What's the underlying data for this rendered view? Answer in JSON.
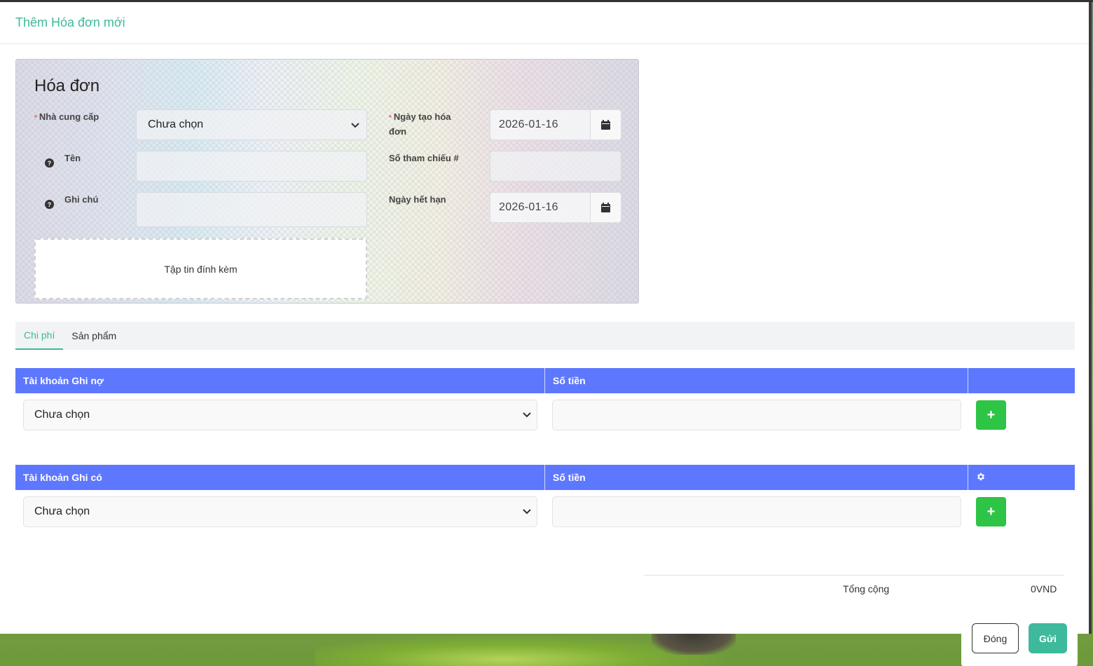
{
  "modal": {
    "title": "Thêm Hóa đơn mới"
  },
  "invoice": {
    "title": "Hóa đơn",
    "supplier_label": "Nhà cung cấp",
    "supplier_value": "Chưa chọn",
    "name_label": "Tên",
    "note_label": "Ghi chú",
    "created_date_label_line1": "Ngày tạo hóa",
    "created_date_label_line2": "đơn",
    "created_date_value": "2026-01-16",
    "reference_label": "Số tham chiếu #",
    "due_date_label": "Ngày hết hạn",
    "due_date_value": "2026-01-16",
    "attachment_label": "Tập tin đính kèm"
  },
  "tabs": [
    {
      "label": "Chi phí",
      "active": true
    },
    {
      "label": "Sản phẩm",
      "active": false
    }
  ],
  "debit_table": {
    "col_account": "Tài khoản Ghi nợ",
    "col_amount": "Số tiền",
    "account_value": "Chưa chọn",
    "add_label": "+"
  },
  "credit_table": {
    "col_account": "Tài khoản Ghi có",
    "col_amount": "Số tiền",
    "account_value": "Chưa chọn",
    "add_label": "+"
  },
  "totals": {
    "label": "Tổng cộng",
    "value": "0VND"
  },
  "footer": {
    "close_label": "Đóng",
    "send_label": "Gửi"
  },
  "icons": {
    "chevron": "chevron-down-icon",
    "calendar": "calendar-icon",
    "help": "question-circle-icon",
    "settings": "gear-icon"
  },
  "colors": {
    "accent": "#3eb99b",
    "table_header": "#5d78ff",
    "add_button": "#2ec445"
  }
}
